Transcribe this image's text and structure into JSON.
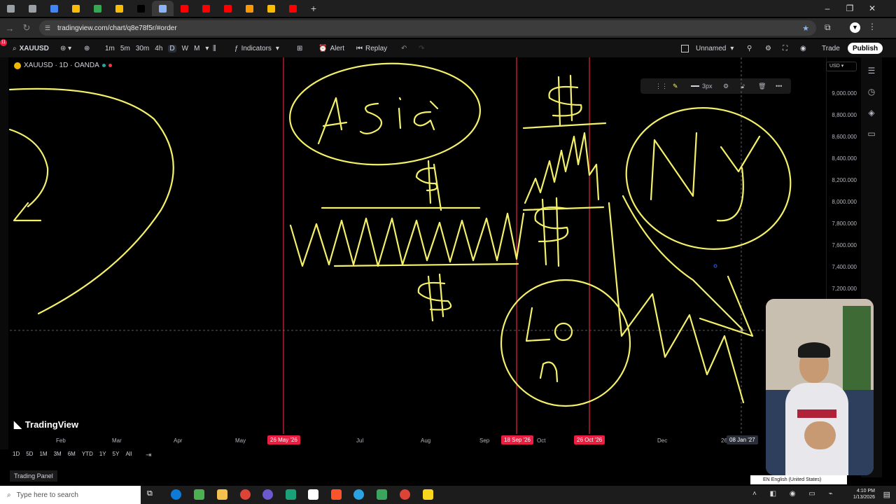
{
  "browser": {
    "url": "tradingview.com/chart/q8e78f5r/#order",
    "tab_colors": [
      "#9aa0a6",
      "#9aa0a6",
      "#4285f4",
      "#fbbc04",
      "#34a853",
      "#fbbc04",
      "#000000",
      "#8ab4f8",
      "#ff0000",
      "#ff0000",
      "#ff0000",
      "#ff9800",
      "#fbbc04",
      "#ff0000"
    ],
    "tab_add": "+",
    "minimize": "–",
    "restore": "❐",
    "close": "✕",
    "notification_badge": "11"
  },
  "toolbar": {
    "symbol": "XAUUSD",
    "intervals": [
      "1m",
      "5m",
      "30m",
      "4h",
      "D",
      "W",
      "M"
    ],
    "indicators": "Indicators",
    "alert": "Alert",
    "replay": "Replay",
    "layout_name": "Unnamed",
    "trade": "Trade",
    "publish": "Publish"
  },
  "legend": {
    "title": "XAUUSD · 1D · OANDA"
  },
  "price_scale": {
    "currency": "USD",
    "labels": [
      "9,000.000",
      "8,800.000",
      "8,600.000",
      "8,400.000",
      "8,200.000",
      "8,000.000",
      "7,800.000",
      "7,600.000",
      "7,400.000",
      "7,200.000"
    ]
  },
  "time_axis": {
    "labels": [
      "Feb",
      "Mar",
      "Apr",
      "May",
      "26 May '26",
      "Jul",
      "Aug",
      "Sep",
      "18 Sep '26",
      "Oct",
      "26 Oct '26",
      "Dec",
      "26",
      "08 Jan '27"
    ]
  },
  "drawing_toolbar": {
    "width_label": "3px"
  },
  "ranges": [
    "1D",
    "5D",
    "1M",
    "3M",
    "6M",
    "YTD",
    "1Y",
    "5Y",
    "All"
  ],
  "brand": "TradingView",
  "trading_panel": "Trading Panel",
  "taskbar": {
    "search_placeholder": "Type here to search",
    "time": "4:10 PM",
    "date": "1/13/2026",
    "language": "EN English (United States)"
  },
  "annotations": {
    "asia": "Asia",
    "ny": "NY",
    "lon": "Lon",
    "dollar": "$"
  },
  "colors": {
    "drawing": "#f5f06a",
    "session_line": "#e91e40",
    "background": "#000000"
  }
}
